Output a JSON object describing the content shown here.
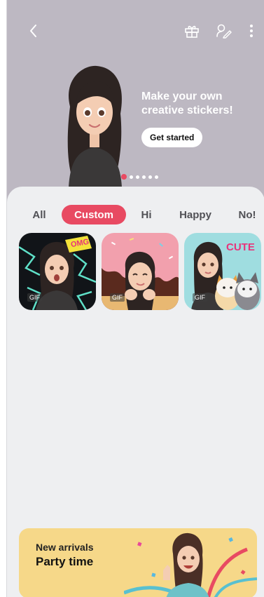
{
  "header": {
    "back_icon": "back-chevron-icon",
    "gift_icon": "gift-icon",
    "sticker_icon": "sticker-edit-icon",
    "more_icon": "more-vertical-icon"
  },
  "hero": {
    "headline_line1": "Make your own",
    "headline_line2": "creative stickers!",
    "cta_label": "Get started",
    "page_count": 6,
    "active_page": 0
  },
  "tabs": [
    {
      "label": "All",
      "active": false
    },
    {
      "label": "Custom",
      "active": true
    },
    {
      "label": "Hi",
      "active": false
    },
    {
      "label": "Happy",
      "active": false
    },
    {
      "label": "No!",
      "active": false
    }
  ],
  "stickers": [
    {
      "badge": "GIF",
      "overlay_text": "OMG"
    },
    {
      "badge": "GIF",
      "overlay_text": ""
    },
    {
      "badge": "GIF",
      "overlay_text": "CUTE"
    }
  ],
  "banner": {
    "subtitle": "New arrivals",
    "title": "Party time"
  },
  "colors": {
    "accent": "#e84a62",
    "hero_bg": "#bdb8c2",
    "sheet_bg": "#eeeff1",
    "banner_bg": "#f6d889"
  }
}
